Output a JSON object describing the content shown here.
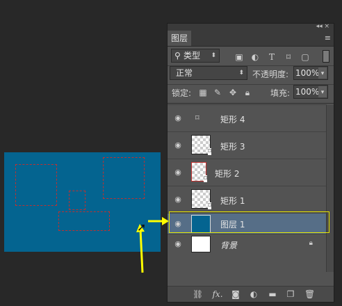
{
  "panel": {
    "tab": "图层",
    "top_controls": "◂◂ ×",
    "menu_icon": "≡",
    "filter": {
      "icon": "search-icon",
      "value": "类型"
    },
    "filter_icons": [
      "image-icon",
      "adjustment-icon",
      "type-icon",
      "shape-icon",
      "smart-object-icon"
    ],
    "blend_mode": "正常",
    "opacity_label": "不透明度:",
    "opacity_value": "100%",
    "lock_label": "锁定:",
    "fill_label": "填充:",
    "fill_value": "100%"
  },
  "layers": [
    {
      "name": "矩形 4",
      "visible": true,
      "selected": false
    },
    {
      "name": "矩形 3",
      "visible": true,
      "selected": false
    },
    {
      "name": "矩形 2",
      "visible": true,
      "selected": false
    },
    {
      "name": "矩形 1",
      "visible": true,
      "selected": false
    },
    {
      "name": "图层 1",
      "visible": true,
      "selected": true,
      "fill": "#046490"
    },
    {
      "name": "背景",
      "visible": true,
      "selected": false,
      "locked": true,
      "fill": "#ffffff"
    }
  ],
  "bottom_icons": [
    "link-icon",
    "fx-icon",
    "mask-icon",
    "adjustment-layer-icon",
    "folder-icon",
    "new-layer-icon",
    "trash-icon"
  ],
  "bottom_labels": {
    "fx": "fx."
  },
  "colors": {
    "canvas": "#046490",
    "selection_border": "#c0302f",
    "selected_layer": "#566e87",
    "highlight": "#e6e600",
    "arrow": "#ffff00"
  }
}
